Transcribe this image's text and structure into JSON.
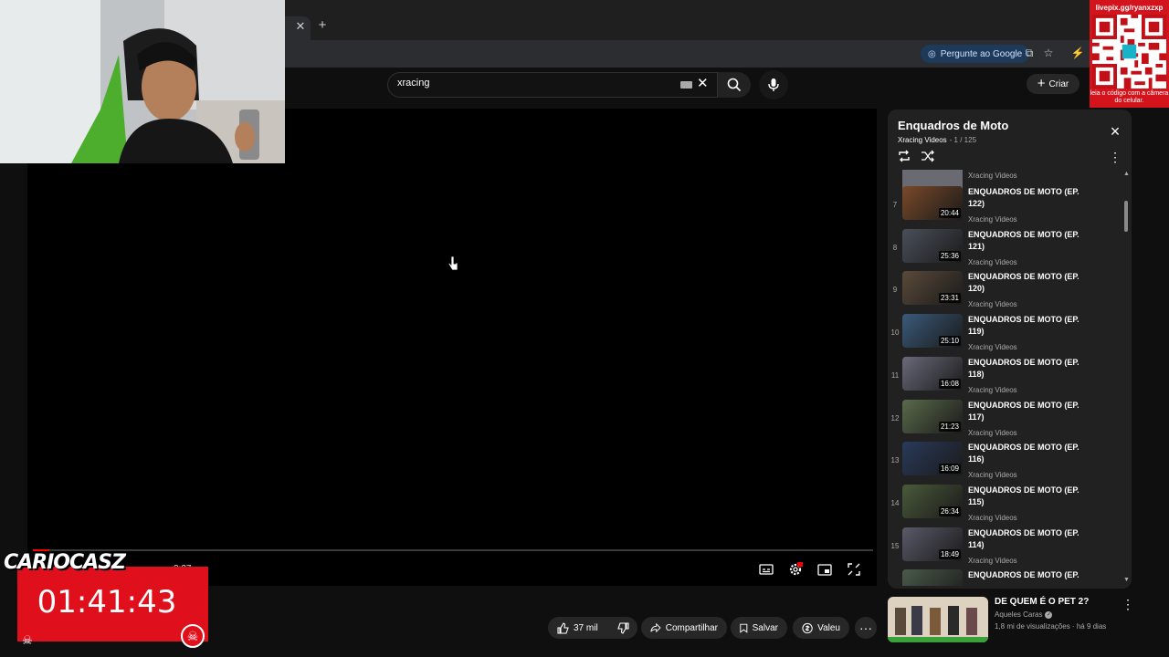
{
  "browser": {
    "tab_close": "✕",
    "new_tab": "+",
    "google_button": "Pergunte ao Google"
  },
  "header": {
    "search_query": "xracing",
    "create_label": "Criar"
  },
  "player": {
    "time": "3:37",
    "progress": 0.02
  },
  "playlist": {
    "title": "Enquadros de Moto",
    "channel": "Xracing Videos",
    "position": "- 1 / 125",
    "partial_top_channel": "Xracing Videos",
    "items": [
      {
        "index": "7",
        "title": "ENQUADROS DE MOTO (EP. 122)",
        "channel": "Xracing Videos",
        "duration": "20:44",
        "color": "#7a4a2a"
      },
      {
        "index": "8",
        "title": "ENQUADROS DE MOTO (EP. 121)",
        "channel": "Xracing Videos",
        "duration": "25:36",
        "color": "#4a4f5a"
      },
      {
        "index": "9",
        "title": "ENQUADROS DE MOTO (EP. 120)",
        "channel": "Xracing Videos",
        "duration": "23:31",
        "color": "#5a4a3a"
      },
      {
        "index": "10",
        "title": "ENQUADROS DE MOTO (EP. 119)",
        "channel": "Xracing Videos",
        "duration": "25:10",
        "color": "#3a5a7a"
      },
      {
        "index": "11",
        "title": "ENQUADROS DE MOTO (EP. 118)",
        "channel": "Xracing Videos",
        "duration": "16:08",
        "color": "#6a6a7a"
      },
      {
        "index": "12",
        "title": "ENQUADROS DE MOTO (EP. 117)",
        "channel": "Xracing Videos",
        "duration": "21:23",
        "color": "#5a6a4a"
      },
      {
        "index": "13",
        "title": "ENQUADROS DE MOTO (EP. 116)",
        "channel": "Xracing Videos",
        "duration": "16:09",
        "color": "#2a3a5a"
      },
      {
        "index": "14",
        "title": "ENQUADROS DE MOTO (EP. 115)",
        "channel": "Xracing Videos",
        "duration": "26:34",
        "color": "#4a5a3a"
      },
      {
        "index": "15",
        "title": "ENQUADROS DE MOTO (EP. 114)",
        "channel": "Xracing Videos",
        "duration": "18:49",
        "color": "#5a5a6a"
      },
      {
        "index": "",
        "title": "ENQUADROS DE MOTO (EP.",
        "channel": "",
        "duration": "",
        "color": "#4a5a4a"
      }
    ]
  },
  "actions": {
    "likes": "37 mil",
    "share": "Compartilhar",
    "save": "Salvar",
    "thanks": "Valeu"
  },
  "recommendation": {
    "title": "DE QUEM É O PET 2?",
    "channel": "Aqueles Caras",
    "meta": "1,8 mi de visualizações · há 9 dias"
  },
  "overlay": {
    "qr_url": "livepix.gg/ryanxzxp",
    "qr_note": "leia o código com a câmera do celular.",
    "timer": "01:41:43",
    "brand": "CARIOCASZ"
  },
  "colors": {
    "accent_red": "#ff0000",
    "panel": "#212121",
    "background": "#0f0f0f"
  }
}
